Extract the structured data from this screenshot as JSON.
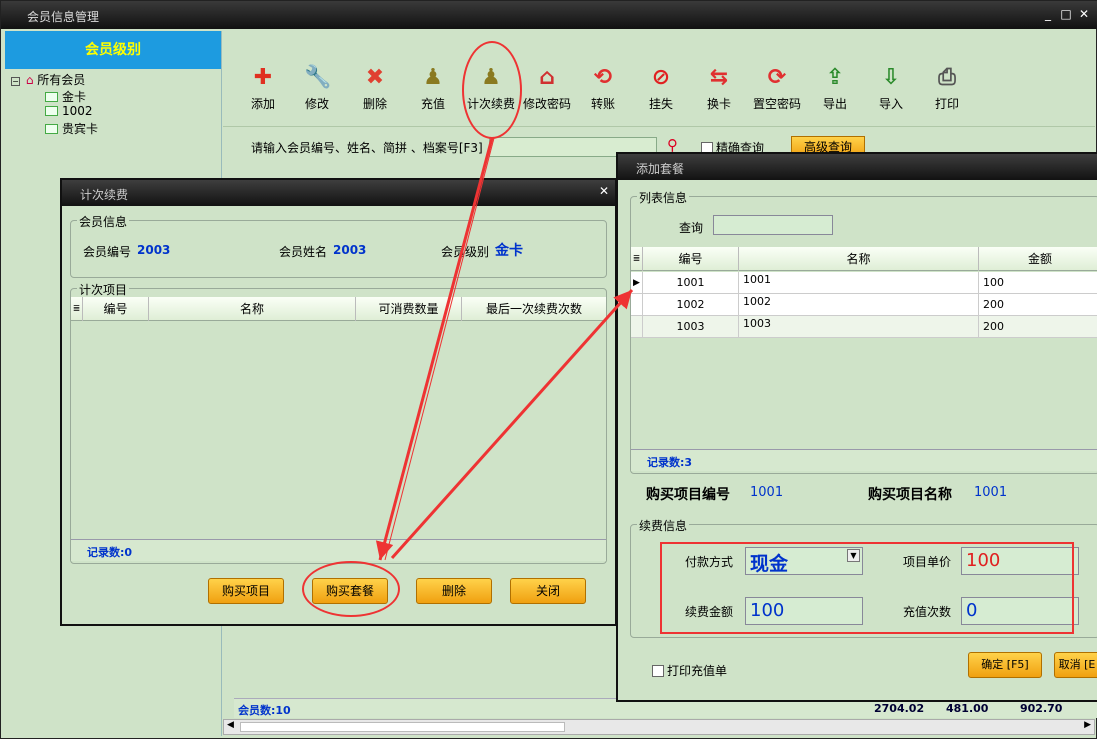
{
  "window": {
    "title": "会员信息管理"
  },
  "sidebar": {
    "header": "会员级别",
    "root": "所有会员",
    "items": [
      "金卡",
      "1002",
      "贵宾卡"
    ]
  },
  "toolbar": {
    "buttons": [
      {
        "label": "添加",
        "icon": "plus-icon",
        "glyph": "✚",
        "color": "#e03020"
      },
      {
        "label": "修改",
        "icon": "wrench-icon",
        "glyph": "🔧",
        "color": "#888"
      },
      {
        "label": "删除",
        "icon": "x-icon",
        "glyph": "✖",
        "color": "#e04030"
      },
      {
        "label": "充值",
        "icon": "pawn-icon",
        "glyph": "♟",
        "color": "#8a7a20"
      },
      {
        "label": "计次续费",
        "icon": "pawn-icon",
        "glyph": "♟",
        "color": "#8a7a20"
      },
      {
        "label": "修改密码",
        "icon": "house-icon",
        "glyph": "⌂",
        "color": "#d03030"
      },
      {
        "label": "转账",
        "icon": "refresh-icon",
        "glyph": "⟲",
        "color": "#e03030"
      },
      {
        "label": "挂失",
        "icon": "no-entry-icon",
        "glyph": "⊘",
        "color": "#e02020"
      },
      {
        "label": "换卡",
        "icon": "swap-icon",
        "glyph": "⇆",
        "color": "#e03030"
      },
      {
        "label": "置空密码",
        "icon": "reset-icon",
        "glyph": "⟳",
        "color": "#e03030"
      },
      {
        "label": "导出",
        "icon": "export-icon",
        "glyph": "⇪",
        "color": "#2a8a2a"
      },
      {
        "label": "导入",
        "icon": "import-icon",
        "glyph": "⇩",
        "color": "#2a8a2a"
      },
      {
        "label": "打印",
        "icon": "printer-icon",
        "glyph": "⎙",
        "color": "#555"
      }
    ]
  },
  "search": {
    "label": "请输入会员编号、姓名、简拼 、档案号[F3]",
    "exact_label": "精确查询",
    "advanced_label": "高级查询"
  },
  "main_status": {
    "count_label": "会员数:10",
    "totals": [
      "2704.02",
      "481.00",
      "902.70"
    ]
  },
  "dialog_count": {
    "title": "计次续费",
    "member_group_label": "会员信息",
    "member_id_label": "会员编号",
    "member_id": "2003",
    "member_name_label": "会员姓名",
    "member_name": "2003",
    "member_level_label": "会员级别",
    "member_level": "金卡",
    "items_group_label": "计次项目",
    "columns": [
      "编号",
      "名称",
      "可消费数量",
      "最后一次续费次数"
    ],
    "record_count": "记录数:0",
    "buttons": {
      "buy_item": "购买项目",
      "buy_package": "购买套餐",
      "delete": "删除",
      "close": "关闭"
    }
  },
  "dialog_package": {
    "title": "添加套餐",
    "list_group_label": "列表信息",
    "query_label": "查询",
    "columns": [
      "编号",
      "名称",
      "金额"
    ],
    "rows": [
      {
        "id": "1001",
        "name": "1001",
        "amount": "100"
      },
      {
        "id": "1002",
        "name": "1002",
        "amount": "200"
      },
      {
        "id": "1003",
        "name": "1003",
        "amount": "200"
      }
    ],
    "record_count": "记录数:3",
    "buy_id_label": "购买项目编号",
    "buy_id": "1001",
    "buy_name_label": "购买项目名称",
    "buy_name": "1001",
    "renew_group_label": "续费信息",
    "pay_method_label": "付款方式",
    "pay_method": "现金",
    "unit_price_label": "项目单价",
    "unit_price": "100",
    "renew_amount_label": "续费金额",
    "renew_amount": "100",
    "charge_times_label": "充值次数",
    "charge_times": "0",
    "print_label": "打印充值单",
    "confirm_label": "确定 [F5]",
    "cancel_label": "取消 [E"
  },
  "colors": {
    "accent_blue": "#1d9be0",
    "annotation_red": "#e33333",
    "button_orange": "#f5b020"
  }
}
